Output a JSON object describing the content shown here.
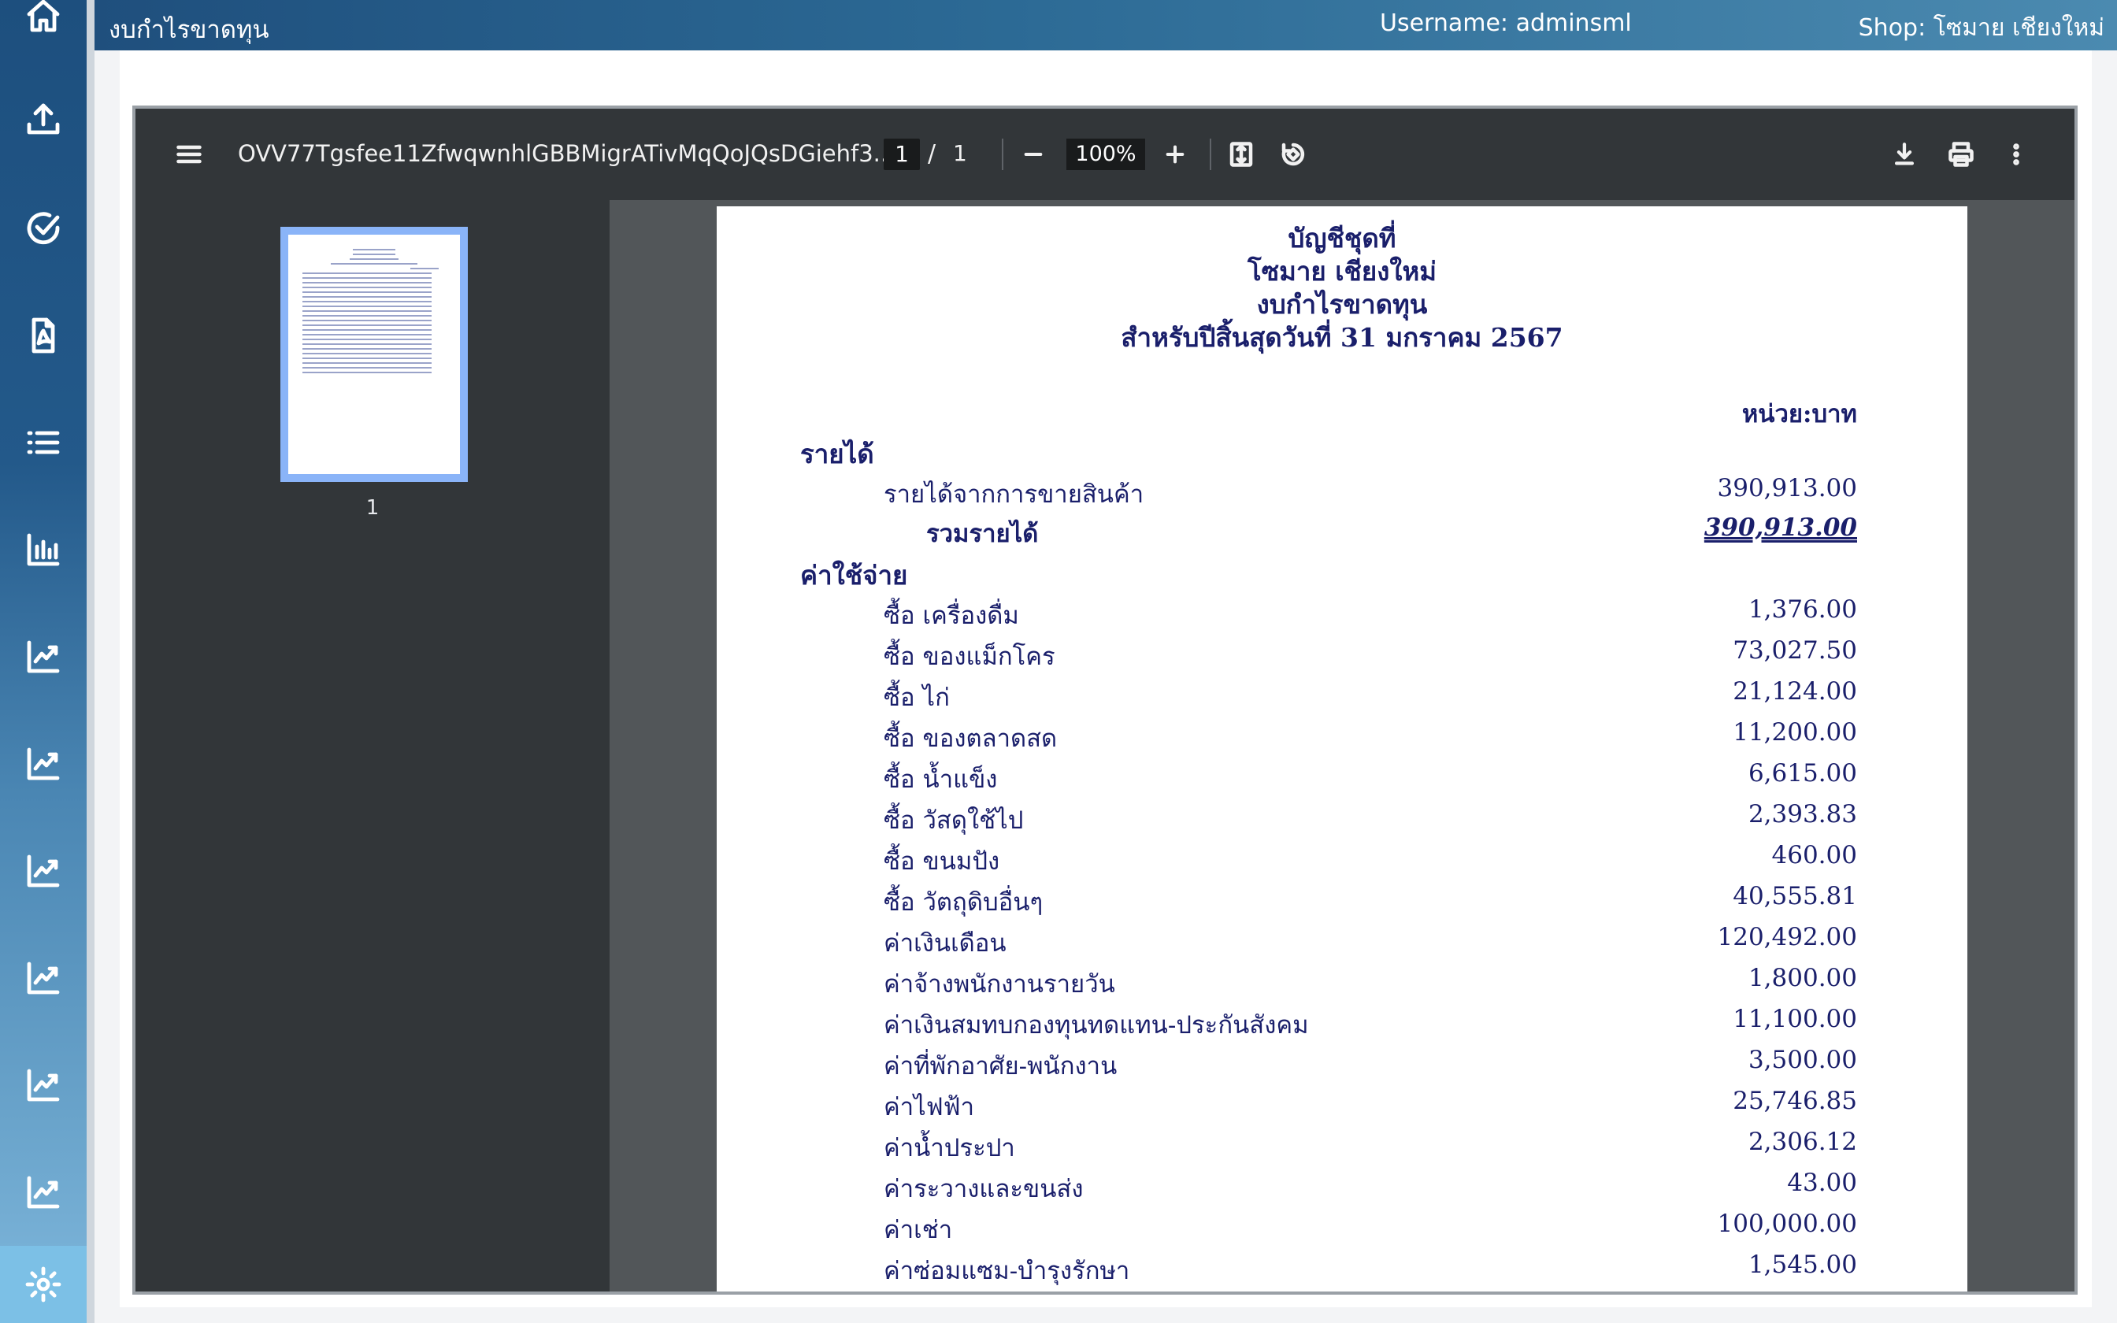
{
  "header": {
    "title": "งบกำไรขาดทุน",
    "username": "Username: adminsml",
    "shop": "Shop: โซมาย เชียงใหม่"
  },
  "sidebar": {
    "items": [
      {
        "icon": "home-icon"
      },
      {
        "icon": "upload-icon"
      },
      {
        "icon": "check-circle-icon"
      },
      {
        "icon": "pdf-file-icon"
      },
      {
        "icon": "list-icon"
      },
      {
        "icon": "bar-chart-icon"
      },
      {
        "icon": "trend-chart-icon"
      },
      {
        "icon": "trend-chart-icon"
      },
      {
        "icon": "trend-chart-icon"
      },
      {
        "icon": "trend-chart-icon"
      },
      {
        "icon": "trend-chart-icon"
      },
      {
        "icon": "trend-chart-icon"
      },
      {
        "icon": "settings-icon"
      }
    ]
  },
  "viewer": {
    "filename": "OVV77Tgsfee11ZfwqwnhlGBBMigrATivMqQoJQsDGiehf3...",
    "page_current": "1",
    "page_sep": "/",
    "page_total": "1",
    "zoom": "100%",
    "thumbnail_label": "1"
  },
  "report": {
    "line1": "บัญชีชุดที่",
    "line2": "โซมาย เชียงใหม่",
    "line3": "งบกำไรขาดทุน",
    "line4": "สำหรับปีสิ้นสุดวันที่ 31 มกราคม 2567",
    "unit": "หน่วย:บาท",
    "income_heading": "รายได้",
    "income_rows": [
      {
        "label": "รายได้จากการขายสินค้า",
        "amount": "390,913.00"
      }
    ],
    "income_total_label": "รวมรายได้",
    "income_total_amount": "390,913.00",
    "expense_heading": "ค่าใช้จ่าย",
    "expense_rows": [
      {
        "label": "ซื้อ เครื่องดื่ม",
        "amount": "1,376.00"
      },
      {
        "label": "ซื้อ ของแม็กโคร",
        "amount": "73,027.50"
      },
      {
        "label": "ซื้อ ไก่",
        "amount": "21,124.00"
      },
      {
        "label": "ซื้อ ของตลาดสด",
        "amount": "11,200.00"
      },
      {
        "label": "ซื้อ น้ำแข็ง",
        "amount": "6,615.00"
      },
      {
        "label": "ซื้อ วัสดุใช้ไป",
        "amount": "2,393.83"
      },
      {
        "label": "ซื้อ ขนมปัง",
        "amount": "460.00"
      },
      {
        "label": "ซื้อ วัตถุดิบอื่นๆ",
        "amount": "40,555.81"
      },
      {
        "label": "ค่าเงินเดือน",
        "amount": "120,492.00"
      },
      {
        "label": "ค่าจ้างพนักงานรายวัน",
        "amount": "1,800.00"
      },
      {
        "label": "ค่าเงินสมทบกองทุนทดแทน-ประกันสังคม",
        "amount": "11,100.00"
      },
      {
        "label": "ค่าที่พักอาศัย-พนักงาน",
        "amount": "3,500.00"
      },
      {
        "label": "ค่าไฟฟ้า",
        "amount": "25,746.85"
      },
      {
        "label": "ค่าน้ำประปา",
        "amount": "2,306.12"
      },
      {
        "label": "ค่าระวางและขนส่ง",
        "amount": "43.00"
      },
      {
        "label": "ค่าเช่า",
        "amount": "100,000.00"
      },
      {
        "label": "ค่าซ่อมแซม-บำรุงรักษา",
        "amount": "1,545.00"
      }
    ]
  }
}
